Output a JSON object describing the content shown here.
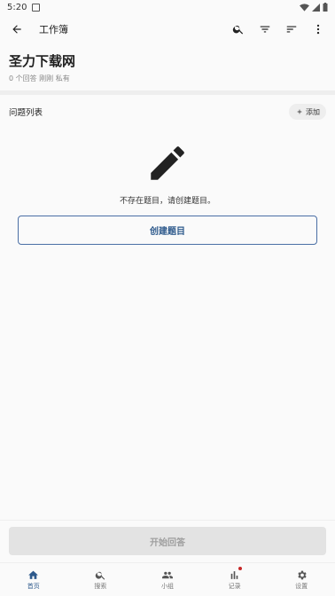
{
  "status_bar": {
    "time": "5:20"
  },
  "app_bar": {
    "title": "工作簿"
  },
  "workbook": {
    "name": "圣力下载网",
    "meta": "0 个回答 刚刚 私有"
  },
  "section": {
    "label": "问题列表",
    "add_label": "添加"
  },
  "empty_state": {
    "message": "不存在题目，请创建题目。",
    "create_label": "创建题目"
  },
  "footer": {
    "start_label": "开始回答"
  },
  "nav": {
    "items": [
      {
        "label": "首页",
        "icon": "home-icon",
        "active": true
      },
      {
        "label": "搜索",
        "icon": "search-icon",
        "active": false
      },
      {
        "label": "小组",
        "icon": "group-icon",
        "active": false
      },
      {
        "label": "记录",
        "icon": "bar-chart-icon",
        "active": false,
        "badge": true
      },
      {
        "label": "设置",
        "icon": "gear-icon",
        "active": false
      }
    ]
  },
  "colors": {
    "accent": "#2e5a8c",
    "badge": "#c62828",
    "disabled_bg": "#e3e3e3",
    "disabled_text": "#9e9e9e"
  }
}
